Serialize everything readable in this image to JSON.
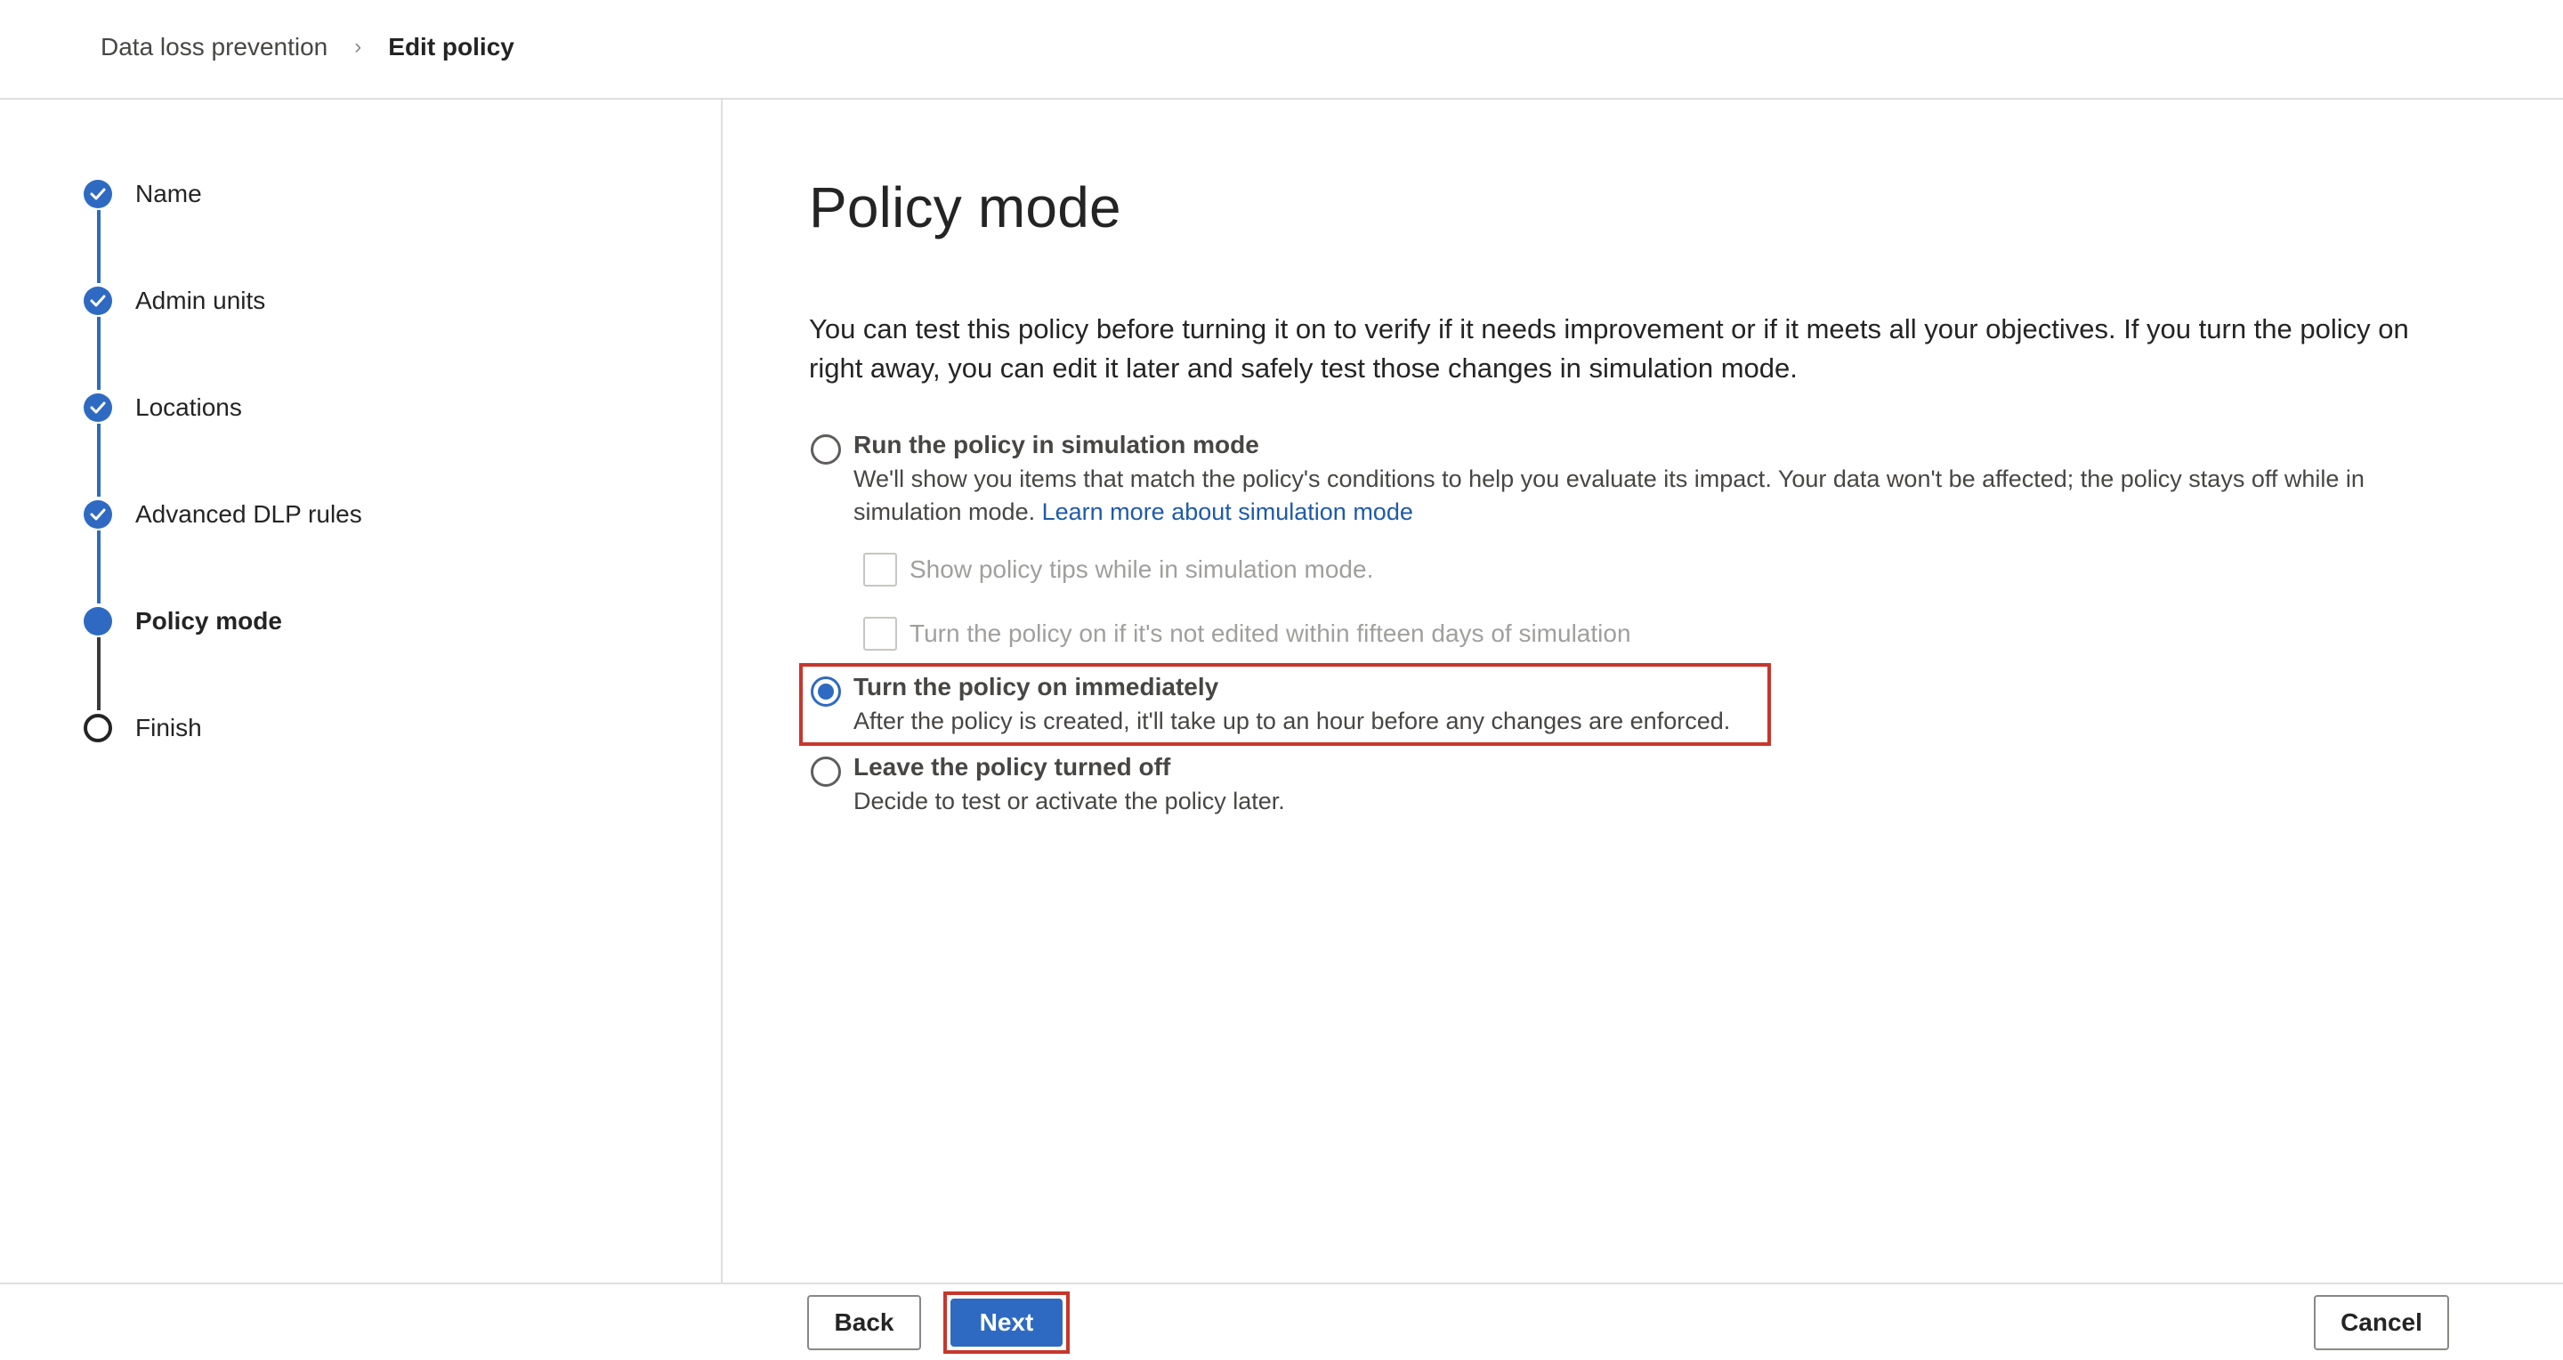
{
  "breadcrumb": {
    "parent": "Data loss prevention",
    "separator": "›",
    "current": "Edit policy"
  },
  "steps": [
    {
      "label": "Name",
      "state": "completed"
    },
    {
      "label": "Admin units",
      "state": "completed"
    },
    {
      "label": "Locations",
      "state": "completed"
    },
    {
      "label": "Advanced DLP rules",
      "state": "completed"
    },
    {
      "label": "Policy mode",
      "state": "current"
    },
    {
      "label": "Finish",
      "state": "upcoming"
    }
  ],
  "main": {
    "title": "Policy mode",
    "description": "You can test this policy before turning it on to verify if it needs improvement or if it meets all your objectives. If you turn the policy on right away, you can edit it later and safely test those changes in simulation mode.",
    "options": [
      {
        "title": "Run the policy in simulation mode",
        "description": "We'll show you items that match the policy's conditions to help you evaluate its impact. Your data won't be affected; the policy stays off while in simulation mode.",
        "link": "Learn more about simulation mode",
        "checked": false
      },
      {
        "title": "Turn the policy on immediately",
        "description": "After the policy is created, it'll take up to an hour before any changes are enforced.",
        "checked": true
      },
      {
        "title": "Leave the policy turned off",
        "description": "Decide to test or activate the policy later.",
        "checked": false
      }
    ],
    "simulation_checkboxes": [
      {
        "label": "Show policy tips while in simulation mode.",
        "checked": false,
        "disabled": true
      },
      {
        "label": "Turn the policy on if it's not edited within fifteen days of simulation",
        "checked": false,
        "disabled": true
      }
    ]
  },
  "footer": {
    "back_label": "Back",
    "next_label": "Next",
    "cancel_label": "Cancel"
  },
  "colors": {
    "accent": "#2f6ac2",
    "highlight": "#c8362b",
    "link": "#1f5aa8"
  }
}
